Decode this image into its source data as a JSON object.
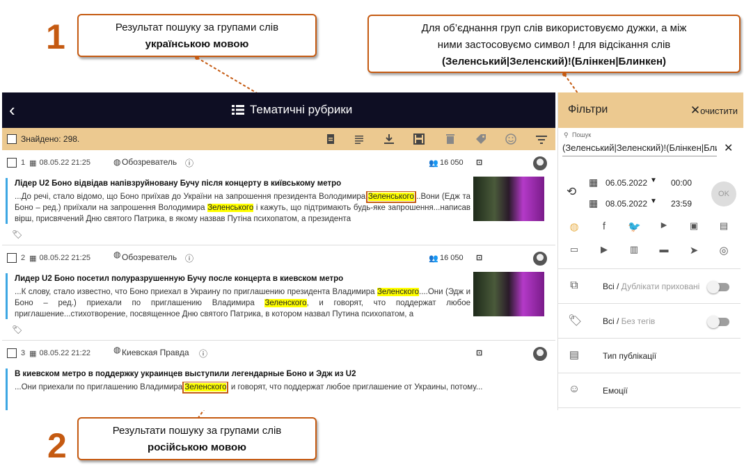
{
  "callouts": {
    "num1": "1",
    "num2": "2",
    "c1_line1": "Результат пошуку за групами слів",
    "c1_line2": "українською мовою",
    "c2_line1": "Результати пошуку за групами слів",
    "c2_line2": "російською мовою",
    "c3_line1": "Для об’єднання груп слів використовуємо дужки, а між",
    "c3_line2": "ними застосовуємо символ ! для відсікання слів",
    "c3_line3": "(Зеленський|Зеленский)!(Блінкен|Блинкен)"
  },
  "header": {
    "back": "‹",
    "title": "Тематичні рубрики"
  },
  "toolbar": {
    "found": "Знайдено: 298."
  },
  "articles": [
    {
      "num": "1",
      "date": "08.05.22 21:25",
      "source": "Обозреватель",
      "reach": "16 050",
      "title": "Лідер U2 Боно відвідав напівзруйновану Бучу після концерту в київському метро",
      "t1": "...До речі, стало відомо, що Боно приїхав до України на запрошення президента Володимира ",
      "h1": "Зеленського",
      "t2": "...Вони (Едж та Боно – ред.) приїхали на запрошення Володимира ",
      "h2": "Зеленського",
      "t3": " і кажуть, що підтримають будь-яке запрошення...написав вірш, присвячений Дню святого Патрика, в якому назвав Путіна психопатом, а президента"
    },
    {
      "num": "2",
      "date": "08.05.22 21:25",
      "source": "Обозреватель",
      "reach": "16 050",
      "title": "Лидер U2 Боно посетил полуразрушенную Бучу после концерта в киевском метро",
      "t1": "...К слову, стало известно, что Боно приехал в Украину по приглашению президента Владимира ",
      "h1": "Зеленского",
      "t2": "....Они (Эдж и Боно – ред.) приехали по приглашению Владимира ",
      "h2": "Зеленского",
      "t3": ", и говорят, что поддержат любое приглашение...стихотворение, посвященное Дню святого Патрика, в котором назвал Путина психопатом, а"
    },
    {
      "num": "3",
      "date": "08.05.22 21:22",
      "source": "Киевская Правда",
      "title": "В киевском метро в поддержку украинцев выступили легендарные Боно и Эдж из U2",
      "t1": "...Они приехали по приглашению Владимира ",
      "h1": "Зеленского",
      "t2": ", и говорят, что поддержат любое приглашение от Украины, потому..."
    }
  ],
  "filters": {
    "title": "Фільтри",
    "clear": "очистити",
    "search_label": "Пошук",
    "search_value": "(Зеленський|Зеленский)!(Блінкен|Блинкен)",
    "date_from": "06.05.2022",
    "time_from": "00:00",
    "date_to": "08.05.2022",
    "time_to": "23:59",
    "ok": "OK",
    "dup_all": "Всі /",
    "dup_hint": " Дублікати приховані",
    "tags_all": "Всі /",
    "tags_hint": " Без тегів",
    "pub_type": "Тип публікації",
    "emotions": "Емоції"
  },
  "colors": {
    "accent": "#c55a11",
    "header_bg": "#0e0e23",
    "toolbar_bg": "#ecc990",
    "highlight": "#ffff00",
    "bar": "#3da7e3"
  }
}
